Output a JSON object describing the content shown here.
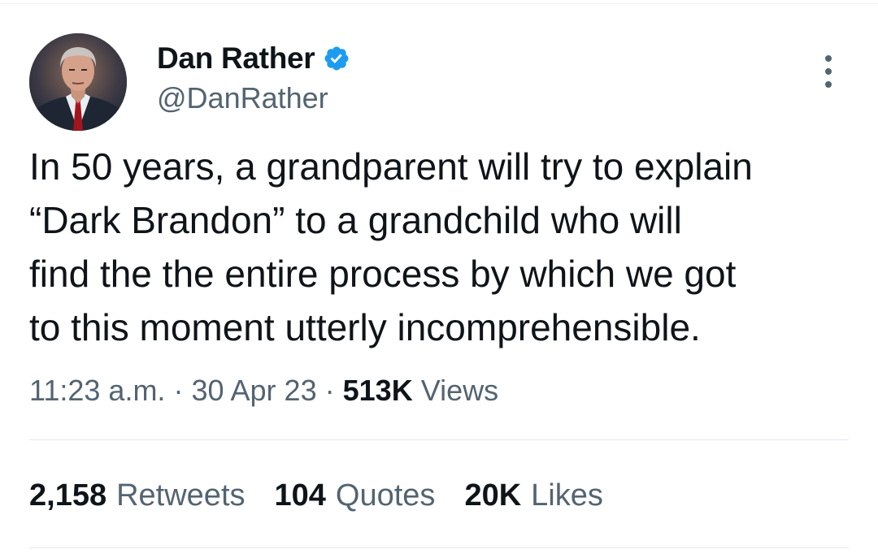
{
  "author": {
    "display_name": "Dan Rather",
    "handle": "@DanRather",
    "verified": true
  },
  "tweet": {
    "text": "In 50 years, a grandparent will try to explain\n“Dark Brandon” to a grandchild who will\nfind the the entire process by which we got\nto this moment utterly incomprehensible."
  },
  "meta": {
    "time": "11:23 a.m.",
    "separator": "·",
    "date": "30 Apr 23",
    "views_count": "513K",
    "views_label": "Views"
  },
  "stats": {
    "retweets_count": "2,158",
    "retweets_label": "Retweets",
    "quotes_count": "104",
    "quotes_label": "Quotes",
    "likes_count": "20K",
    "likes_label": "Likes"
  },
  "colors": {
    "verified_badge": "#1d9bf0",
    "secondary_text": "#536471",
    "primary_text": "#0f1419"
  },
  "icons": {
    "verified": "verified-badge-icon",
    "more": "more-options-icon"
  }
}
